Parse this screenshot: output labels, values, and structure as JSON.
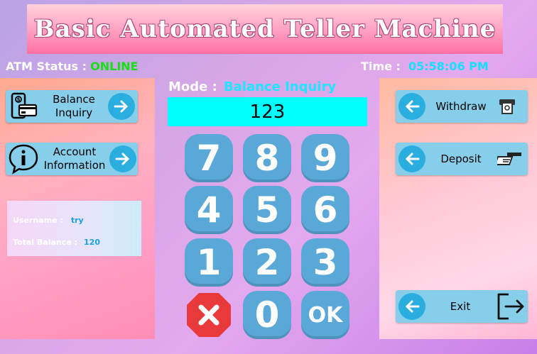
{
  "header": {
    "title": "Basic Automated Teller Machine"
  },
  "status": {
    "label": "ATM Status :",
    "value": "ONLINE",
    "color": "#14e014"
  },
  "clock": {
    "label": "Time :",
    "value": "05:58:06 PM"
  },
  "left_buttons": [
    {
      "label_line1": "Balance",
      "label_line2": "Inquiry",
      "icon": "phone-card-icon"
    },
    {
      "label_line1": "Account",
      "label_line2": "Information",
      "icon": "info-icon"
    }
  ],
  "user_info": {
    "username_label": "Username :",
    "username": "try",
    "balance_label": "Total Balance :",
    "balance": "120"
  },
  "mode": {
    "label": "Mode :",
    "value": "Balance Inquiry"
  },
  "display": {
    "value": "123"
  },
  "keypad": [
    "7",
    "8",
    "9",
    "4",
    "5",
    "6",
    "1",
    "2",
    "3",
    "cancel",
    "0",
    "OK"
  ],
  "right_buttons": [
    {
      "label": "Withdraw",
      "icon": "cash-withdraw-icon"
    },
    {
      "label": "Deposit",
      "icon": "cash-deposit-icon"
    },
    {
      "label": "Exit",
      "icon": "exit-icon"
    }
  ],
  "colors": {
    "accent": "#87ceeb",
    "key": "#5aa8d8",
    "display": "#00ffff",
    "cancel": "#e83a3a"
  }
}
